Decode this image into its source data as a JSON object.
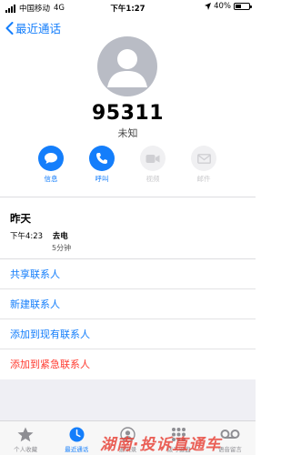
{
  "status_bar": {
    "carrier": "中国移动",
    "network": "4G",
    "time": "下午1:27",
    "battery": "40%",
    "battery_level": 0.4
  },
  "nav": {
    "back_label": "最近通话"
  },
  "contact": {
    "number": "95311",
    "subtitle": "未知"
  },
  "actions": [
    {
      "label": "信息",
      "icon": "message-icon",
      "enabled": true
    },
    {
      "label": "呼叫",
      "icon": "phone-icon",
      "enabled": true
    },
    {
      "label": "视频",
      "icon": "video-icon",
      "enabled": false
    },
    {
      "label": "邮件",
      "icon": "mail-icon",
      "enabled": false
    }
  ],
  "recents": {
    "date": "昨天",
    "time": "下午4:23",
    "type": "去电",
    "duration": "5分钟"
  },
  "links": [
    {
      "label": "共享联系人"
    },
    {
      "label": "新建联系人"
    },
    {
      "label": "添加到现有联系人"
    },
    {
      "label": "添加到紧急联系人"
    }
  ],
  "tabs": [
    {
      "label": "个人收藏",
      "icon": "star-icon"
    },
    {
      "label": "最近通话",
      "icon": "clock-icon",
      "active": true
    },
    {
      "label": "通讯录",
      "icon": "contacts-icon"
    },
    {
      "label": "拨号键盘",
      "icon": "keypad-icon"
    },
    {
      "label": "语音留言",
      "icon": "voicemail-icon"
    }
  ],
  "watermark": "湖南·投诉直通车",
  "colors": {
    "accent": "#147EFB",
    "destructive": "#FF3B30",
    "disabled": "#C9C9CC"
  }
}
